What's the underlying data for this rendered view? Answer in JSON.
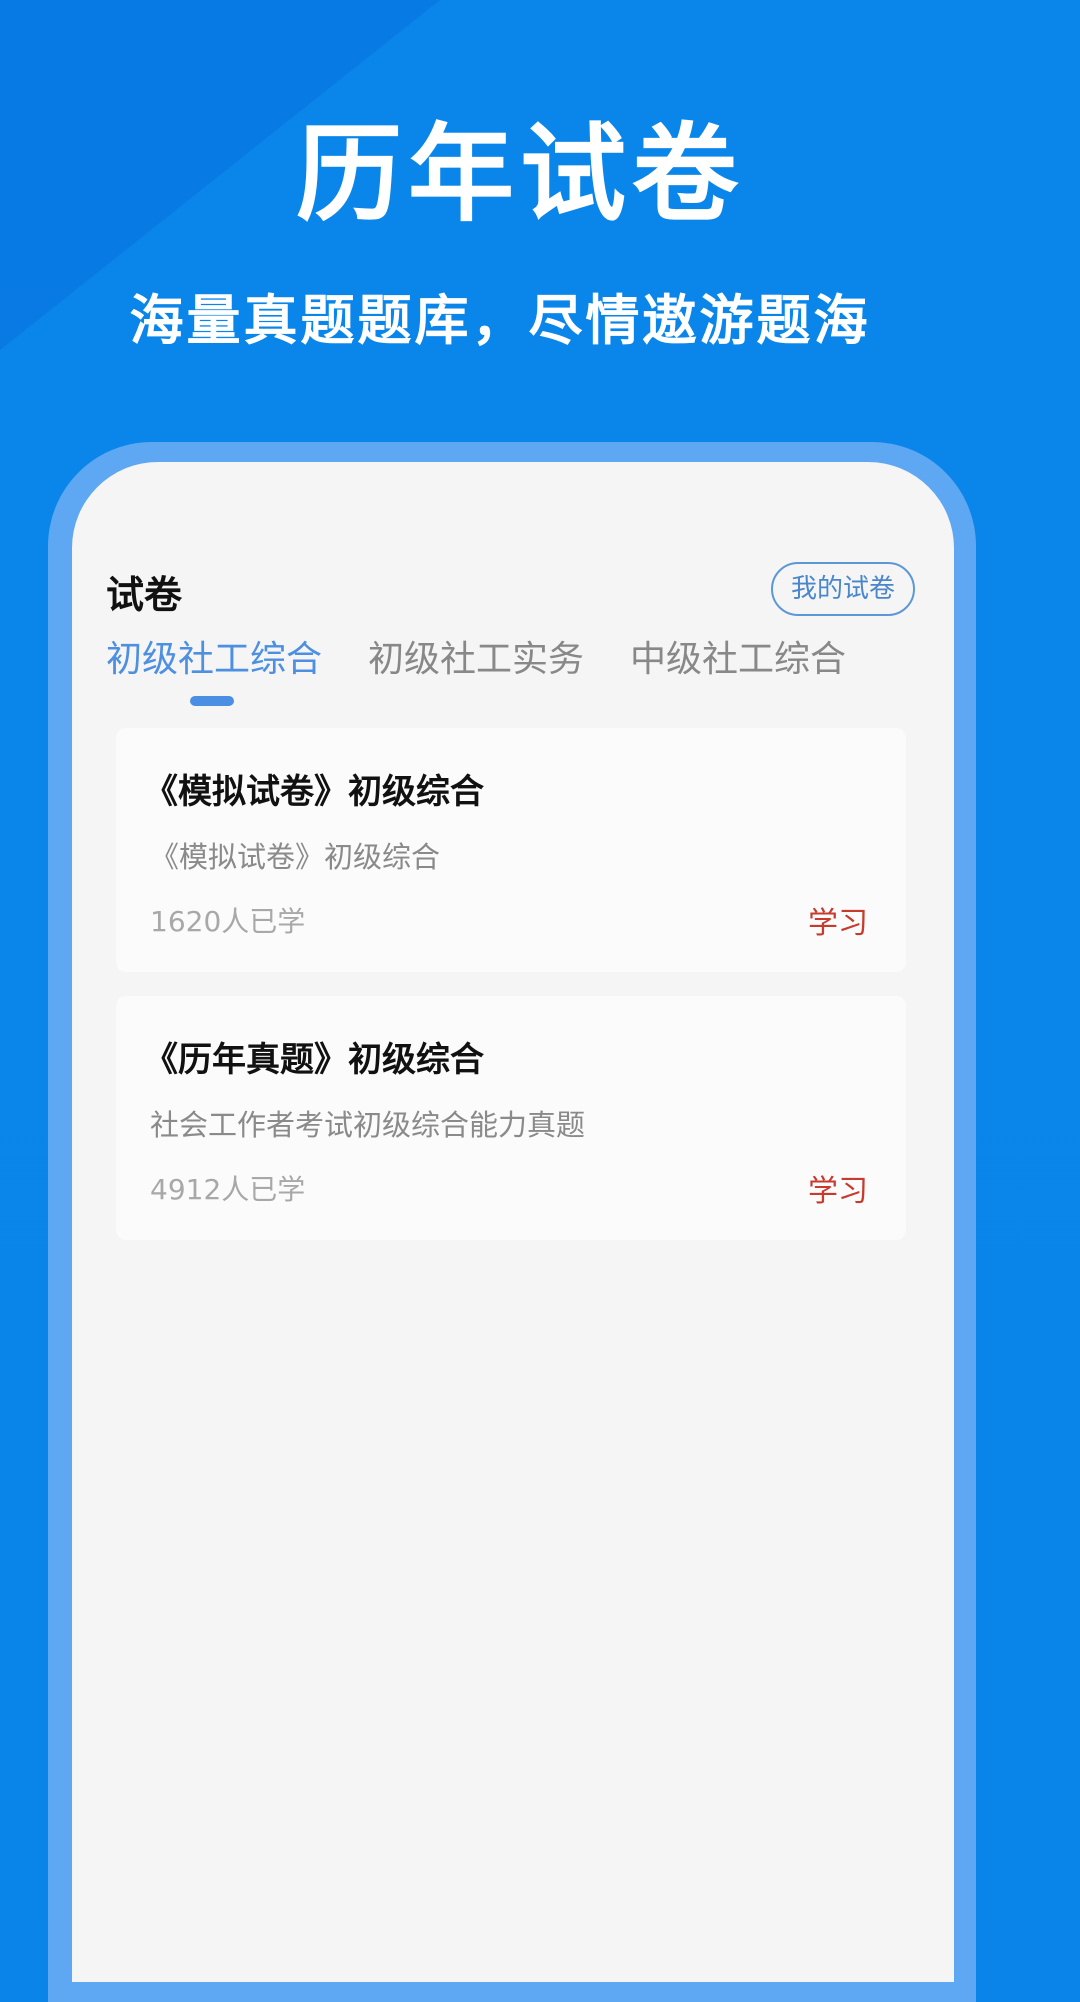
{
  "hero": {
    "title": "历年试卷",
    "subtitle": "海量真题题库，尽情遨游题海"
  },
  "screen": {
    "section_title": "试卷",
    "my_papers_button": "我的试卷",
    "tabs": [
      {
        "label": "初级社工综合",
        "active": true
      },
      {
        "label": "初级社工实务",
        "active": false
      },
      {
        "label": "中级社工综合",
        "active": false
      }
    ],
    "cards": [
      {
        "title": "《模拟试卷》初级综合",
        "description": "《模拟试卷》初级综合",
        "count": "1620人已学",
        "action": "学习"
      },
      {
        "title": "《历年真题》初级综合",
        "description": "社会工作者考试初级综合能力真题",
        "count": "4912人已学",
        "action": "学习"
      }
    ]
  },
  "colors": {
    "background": "#0b84ea",
    "accent": "#4d8fe0",
    "action": "#c83a2d"
  }
}
